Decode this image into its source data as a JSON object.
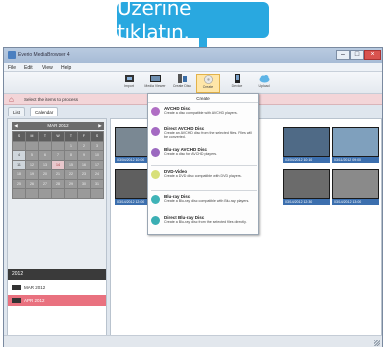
{
  "callout": {
    "text": "Üzerine tıklatın."
  },
  "window": {
    "title": "Everio MediaBrowser 4",
    "buttons": {
      "min": "–",
      "max": "□",
      "close": "×"
    }
  },
  "menu": [
    "File",
    "Edit",
    "View",
    "Help"
  ],
  "toolbar": [
    {
      "label": "Import",
      "icon": "import-icon"
    },
    {
      "label": "Media Viewer",
      "icon": "media-viewer-icon"
    },
    {
      "label": "Create Disc",
      "icon": "create-disc-icon"
    },
    {
      "label": "Create",
      "icon": "create-icon",
      "active": true
    },
    {
      "label": "Device",
      "icon": "device-icon"
    },
    {
      "label": "Upload",
      "icon": "upload-icon"
    }
  ],
  "breadcrumb": "Select the items to process",
  "tabs": [
    {
      "label": "List"
    },
    {
      "label": "Calendar"
    }
  ],
  "calendar": {
    "header": "MAR 2012",
    "weekdays": [
      "S",
      "M",
      "T",
      "W",
      "T",
      "F",
      "S"
    ],
    "days": [
      "",
      "",
      "",
      "",
      "1",
      "2",
      "3",
      "4",
      "5",
      "6",
      "7",
      "8",
      "9",
      "10",
      "11",
      "12",
      "13",
      "14",
      "15",
      "16",
      "17",
      "18",
      "19",
      "20",
      "21",
      "22",
      "23",
      "24",
      "25",
      "26",
      "27",
      "28",
      "29",
      "30",
      "31",
      "",
      "",
      "",
      "",
      "",
      "",
      ""
    ],
    "highlighted": [
      "14"
    ],
    "active": [
      "4",
      "11"
    ]
  },
  "datelist": {
    "year": "2012",
    "items": [
      {
        "label": "MAR 2012",
        "selected": false
      },
      {
        "label": "APR 2012",
        "selected": true
      }
    ]
  },
  "thumbnails": [
    {
      "caption": "03/04/2012 10:00",
      "color": "#7a8893"
    },
    {
      "caption": "03/04/2012 10:10",
      "color": "#4f6a86"
    },
    {
      "caption": "03/11/2012 09:00",
      "color": "#7fa0bd"
    },
    {
      "caption": "03/14/2012 12:00",
      "color": "#5f5f5f"
    },
    {
      "caption": "03/14/2012 12:30",
      "color": "#6b6b6b"
    },
    {
      "caption": "03/14/2012 13:00",
      "color": "#8a8a8a"
    }
  ],
  "dropdown": {
    "title": "Create",
    "items": [
      {
        "name": "AVCHD Disc",
        "desc": "Create a disc compatible with AVCHD players.",
        "icon_color": "#b06ec4"
      },
      {
        "name": "Direct AVCHD Disc",
        "desc": "Create an AVCHD disc from the selected files. Files will be converted.",
        "icon_color": "#a46ac2"
      },
      {
        "name": "Blu-ray AVCHD Disc",
        "desc": "Create a disc for AVCHD players.",
        "icon_color": "#9b69c0"
      },
      {
        "name": "DVD-Video",
        "desc": "Create a DVD disc compatible with DVD players.",
        "icon_color": "#d8e07a"
      },
      {
        "name": "Blu-ray Disc",
        "desc": "Create a Blu-ray disc compatible with Blu-ray players.",
        "icon_color": "#3fb3b7"
      },
      {
        "name": "Direct Blu-ray Disc",
        "desc": "Create a Blu-ray disc from the selected files directly.",
        "icon_color": "#3aaeb3"
      }
    ]
  }
}
